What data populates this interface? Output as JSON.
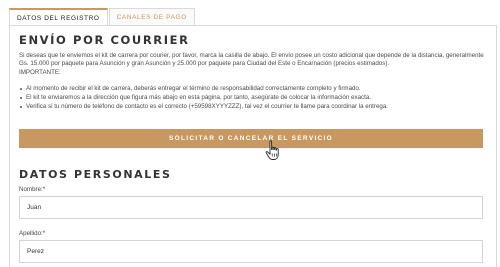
{
  "tabs": [
    {
      "label": "DATOS DEL REGISTRO",
      "active": true
    },
    {
      "label": "CANALES DE PAGO",
      "active": false
    }
  ],
  "envio": {
    "title": "ENVÍO POR COURRIER",
    "intro": "Si deseas que te enviemos el kit de carrera por courier, por favor, marca la casilla de abajo. El envío posee un costo adicional que depende de la distancia, generalmente Gs. 15.000 por paquete para Asunción y gran Asunción y 25.000 por paquete para Ciudad del Este o Encarnación (precios estimados).",
    "important": "IMPORTANTE:",
    "bullets": [
      "Al momento de recibir el kit de carrera, deberás entregar el término de responsabilidad correctamente completo y firmado.",
      "El kit te enviaremos a la dirección que figura más abajo en esta página, por tanto, asegúrate de colocar la información exacta.",
      "Verifica si tu número de teléfono de contacto es el correcto (+59598XYYYZZZ), tal vez el courrier te llame para coordinar la entrega."
    ],
    "button_label": "SOLICITAR O CANCELAR EL SERVICIO"
  },
  "datos": {
    "title": "DATOS PERSONALES",
    "nombre_label": "Nombre:*",
    "nombre_value": "Juan",
    "apellido_label": "Apellido:*",
    "apellido_value": "Perez"
  },
  "colors": {
    "accent": "#c79860",
    "border": "#d9d9d9"
  },
  "icons": {
    "cursor": "hand-pointer-icon"
  }
}
